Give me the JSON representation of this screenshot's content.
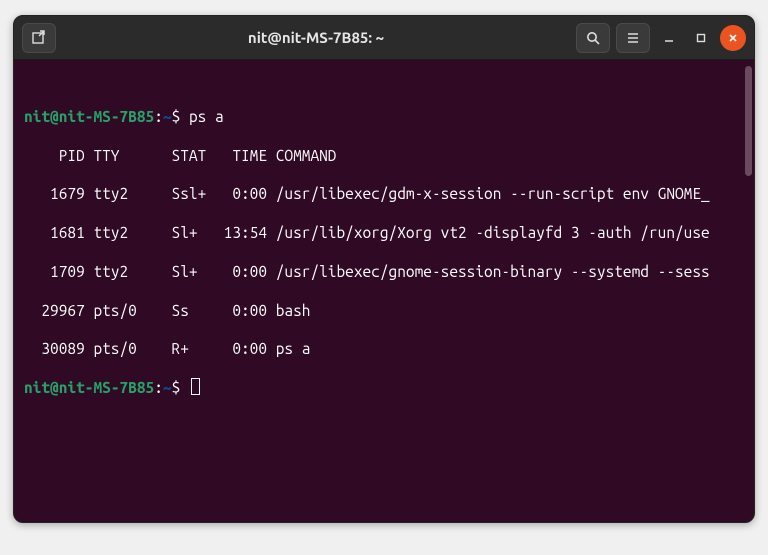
{
  "titlebar": {
    "title": "nit@nit-MS-7B85: ~"
  },
  "prompt": {
    "user": "nit",
    "at": "@",
    "host": "nit-MS-7B85",
    "colon": ":",
    "path": "~",
    "dollar": "$"
  },
  "cmd1": "ps a",
  "header": "    PID TTY      STAT   TIME COMMAND",
  "rows": [
    "   1679 tty2     Ssl+   0:00 /usr/libexec/gdm-x-session --run-script env GNOME_",
    "   1681 tty2     Sl+   13:54 /usr/lib/xorg/Xorg vt2 -displayfd 3 -auth /run/use",
    "   1709 tty2     Sl+    0:00 /usr/libexec/gnome-session-binary --systemd --sess",
    "  29967 pts/0    Ss     0:00 bash",
    "  30089 pts/0    R+     0:00 ps a"
  ]
}
